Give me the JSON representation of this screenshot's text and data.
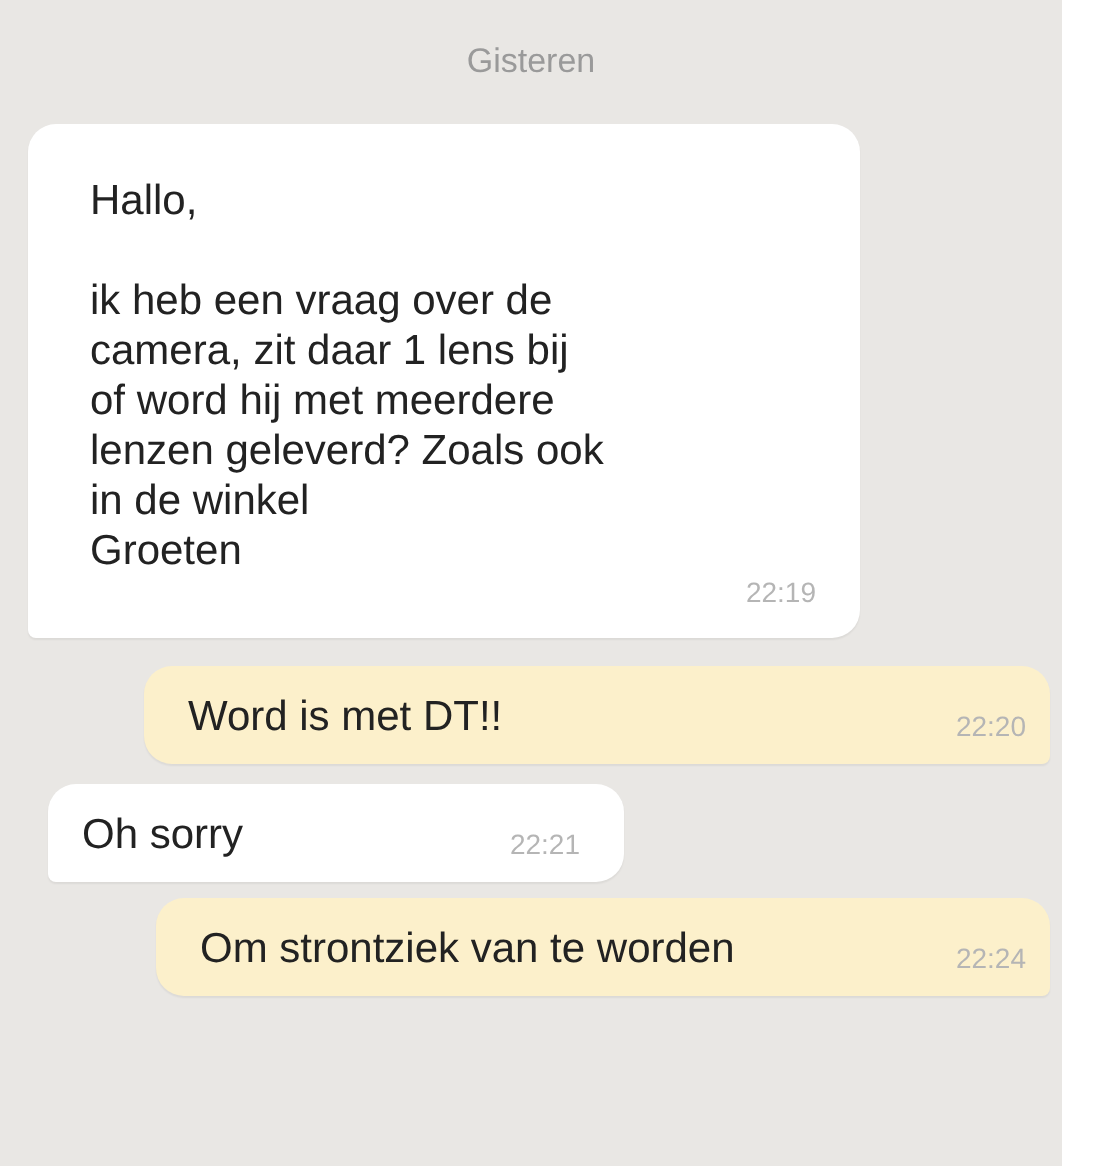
{
  "day_label": "Gisteren",
  "messages": [
    {
      "kind": "incoming",
      "paragraphs": [
        "Hallo,",
        "ik  heb een vraag over de\ncamera, zit daar 1 lens bij\nof word hij met meerdere\nlenzen geleverd? Zoals ook\nin de winkel\nGroeten"
      ],
      "time": "22:19"
    },
    {
      "kind": "outgoing",
      "paragraphs": [
        "Word is met DT!!"
      ],
      "time": "22:20"
    },
    {
      "kind": "incoming",
      "paragraphs": [
        "Oh sorry"
      ],
      "time": "22:21"
    },
    {
      "kind": "outgoing",
      "paragraphs": [
        "Om strontziek van te worden"
      ],
      "time": "22:24"
    }
  ]
}
